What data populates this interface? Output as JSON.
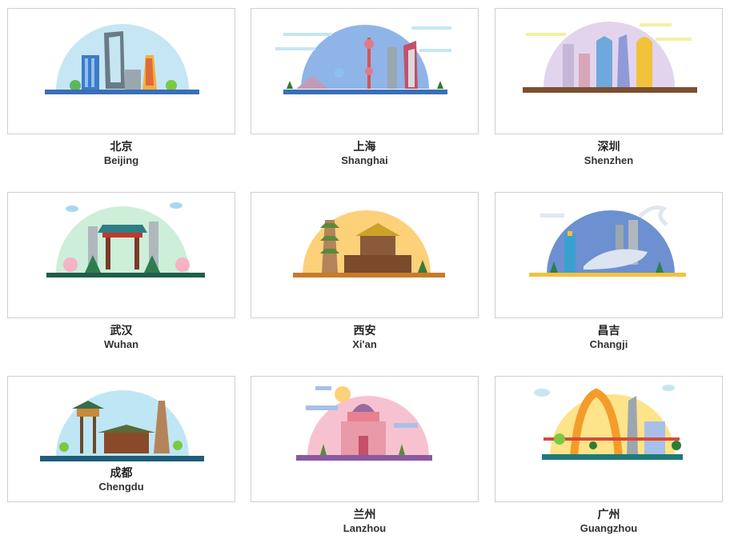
{
  "cities": [
    {
      "cn": "北京",
      "en": "Beijing"
    },
    {
      "cn": "上海",
      "en": "Shanghai"
    },
    {
      "cn": "深圳",
      "en": "Shenzhen"
    },
    {
      "cn": "武汉",
      "en": "Wuhan"
    },
    {
      "cn": "西安",
      "en": "Xi'an"
    },
    {
      "cn": "昌吉",
      "en": "Changji"
    },
    {
      "cn": "成都",
      "en": "Chengdu"
    },
    {
      "cn": "兰州",
      "en": "Lanzhou"
    },
    {
      "cn": "广州",
      "en": "Guangzhou"
    }
  ]
}
